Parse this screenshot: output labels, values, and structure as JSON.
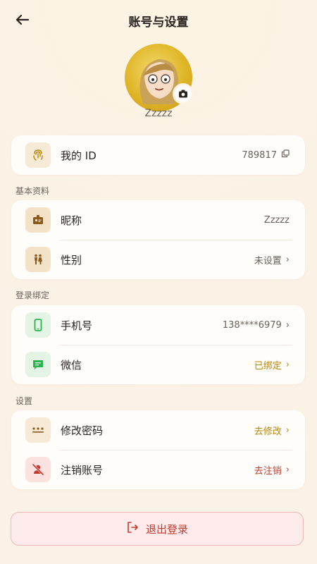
{
  "header": {
    "title": "账号与设置",
    "back_icon": "arrow-left-icon"
  },
  "profile": {
    "nickname": "Zzzzz",
    "camera_icon": "camera-icon"
  },
  "id_card": {
    "label": "我的 ID",
    "value": "789817",
    "icon": "fingerprint-icon",
    "copy_icon": "copy-icon"
  },
  "basic": {
    "section_title": "基本资料",
    "nickname": {
      "label": "昵称",
      "value": "Zzzzz",
      "icon": "id-badge-icon"
    },
    "gender": {
      "label": "性别",
      "value": "未设置",
      "icon": "gender-icon"
    }
  },
  "binding": {
    "section_title": "登录绑定",
    "phone": {
      "label": "手机号",
      "value": "138****6979",
      "icon": "phone-icon"
    },
    "wechat": {
      "label": "微信",
      "value": "已绑定",
      "icon": "chat-icon"
    }
  },
  "settings": {
    "section_title": "设置",
    "password": {
      "label": "修改密码",
      "value": "去修改",
      "icon": "password-dots-icon"
    },
    "delete": {
      "label": "注销账号",
      "value": "去注销",
      "icon": "user-remove-icon"
    }
  },
  "logout": {
    "label": "退出登录",
    "icon": "logout-icon"
  },
  "chevron": "›",
  "colors": {
    "accent_gold": "#b8860b",
    "danger_red": "#c23a2f",
    "wechat_green": "#2bb24c"
  }
}
